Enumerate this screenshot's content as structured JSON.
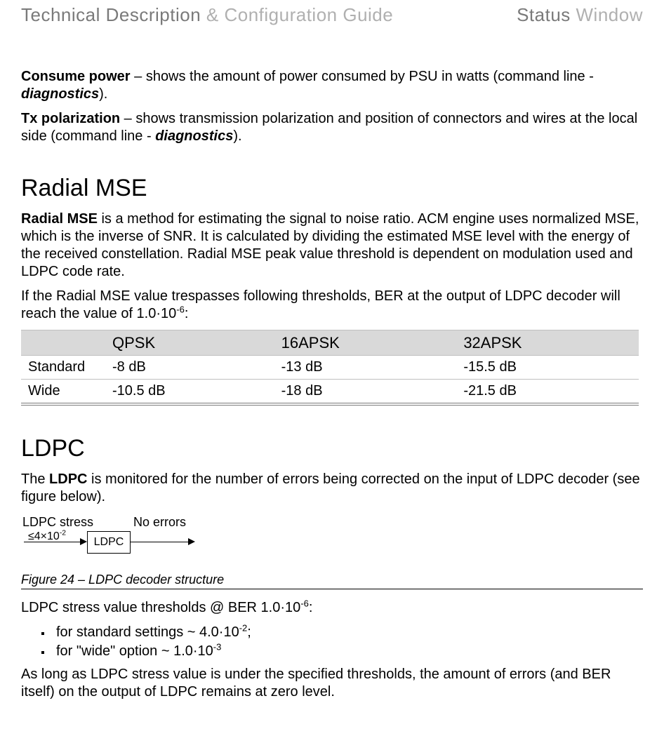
{
  "header": {
    "left_dark": "Technical Description",
    "left_light": " & Configuration Guide",
    "right_dark": "Status",
    "right_light": " Window"
  },
  "intro": {
    "consume_label": "Consume power",
    "consume_text": " – shows the amount of power consumed by PSU in watts (command line - ",
    "consume_cmd": "diagnostics",
    "consume_end": ").",
    "txpol_label": "Tx polarization",
    "txpol_text": " – shows transmission polarization and position of connectors and wires at the local side (command line - ",
    "txpol_cmd": "diagnostics",
    "txpol_end": ")."
  },
  "radial": {
    "heading": "Radial MSE",
    "lead_bold": "Radial MSE",
    "lead_text": " is a method for estimating the signal to noise ratio. ACM engine uses normalized MSE, which is the inverse of SNR. It is calculated by dividing the estimated MSE level with the energy of the received constellation. Radial MSE peak value threshold is dependent on modulation used and LDPC code rate.",
    "threshold_pre": "If the Radial MSE value trespasses following thresholds, BER at the output of LDPC decoder will reach the value of 1.0·10",
    "threshold_exp": "-6",
    "threshold_post": ":",
    "table": {
      "cols": [
        "",
        "QPSK",
        "16APSK",
        "32APSK"
      ],
      "rows": [
        {
          "label": "Standard",
          "v": [
            "-8 dB",
            "-13 dB",
            "-15.5 dB"
          ]
        },
        {
          "label": "Wide",
          "v": [
            "-10.5 dB",
            "-18 dB",
            "-21.5 dB"
          ]
        }
      ]
    }
  },
  "ldpc": {
    "heading": "LDPC",
    "lead_pre": "The ",
    "lead_bold": "LDPC",
    "lead_post": " is monitored for the number of errors being corrected on the input of LDPC decoder (see figure below).",
    "diagram": {
      "stress_label": "LDPC stress",
      "stress_pre": "≤4×10",
      "stress_exp": "-2",
      "box": "LDPC",
      "noerr": "No errors"
    },
    "figure_caption": "Figure 24 – LDPC decoder structure",
    "thresh_pre": "LDPC stress value thresholds @ BER 1.0·10",
    "thresh_exp": "-6",
    "thresh_post": ":",
    "bullets": {
      "b1_pre": "for standard settings ~ 4.0·10",
      "b1_exp": "-2",
      "b1_post": ";",
      "b2_pre": "for \"wide\" option ~ 1.0·10",
      "b2_exp": "-3",
      "b2_post": ""
    },
    "closing": "As long as LDPC stress value is under the specified thresholds, the amount of errors (and BER itself) on the output of LDPC remains at zero level."
  }
}
